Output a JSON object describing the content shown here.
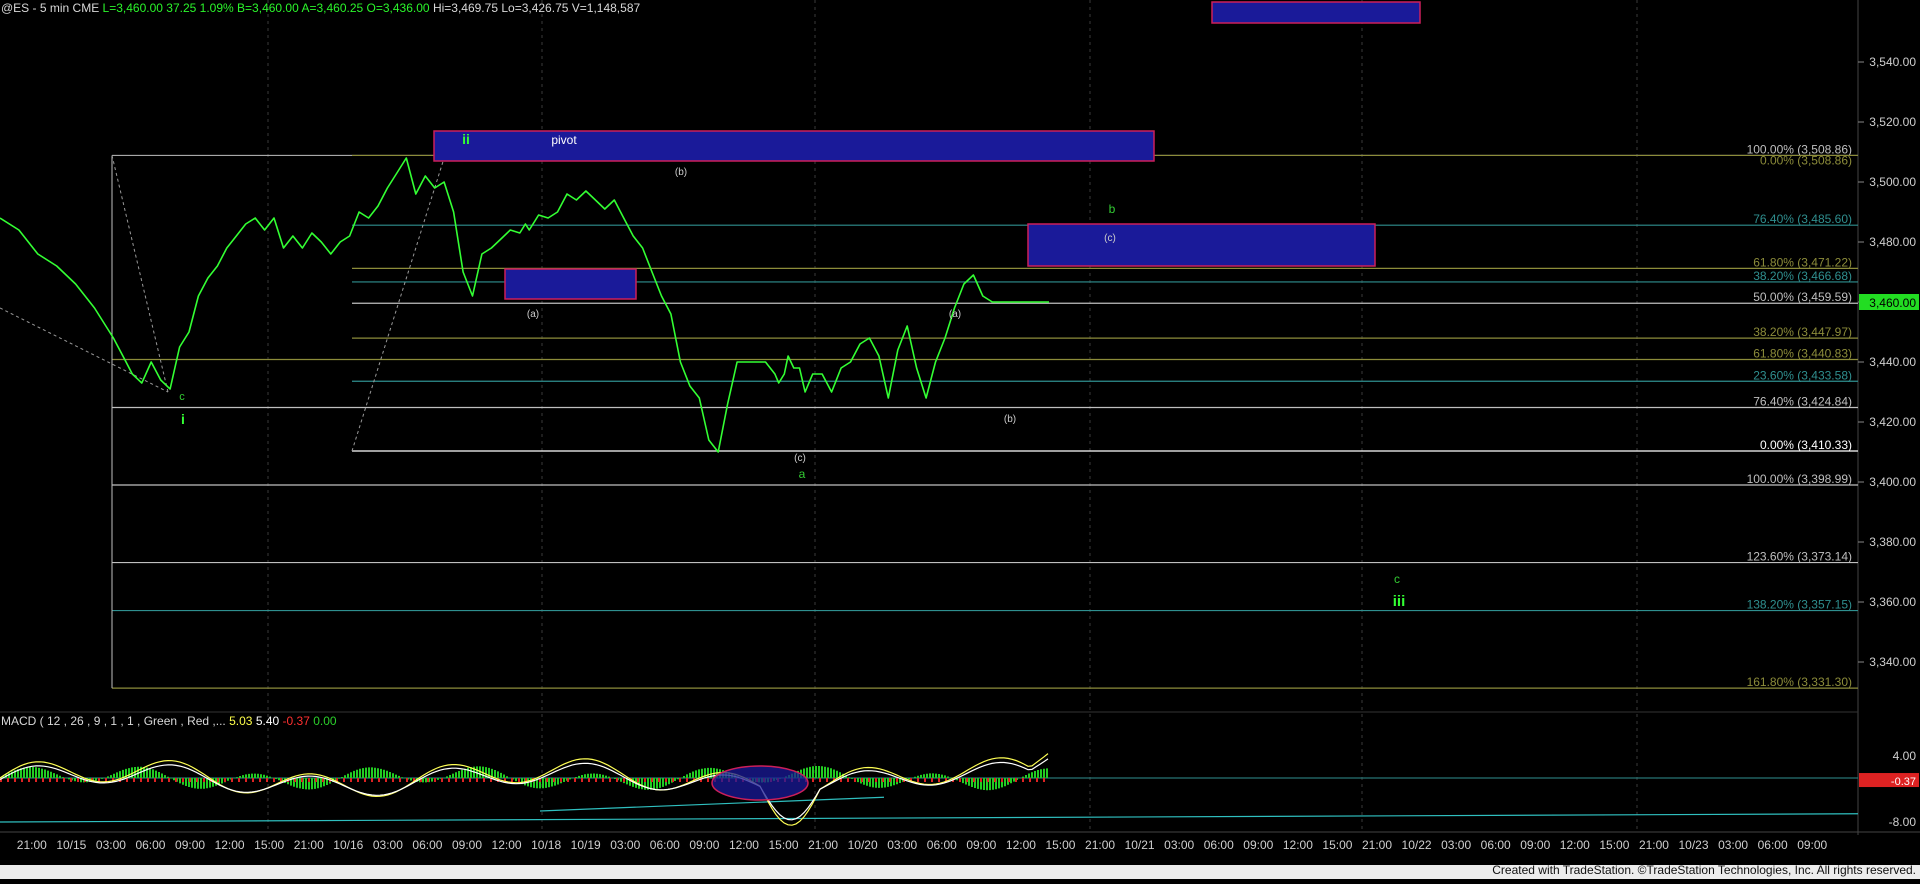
{
  "header": {
    "symbol": "@ES - 5 min  CME",
    "last": "L=3,460.00",
    "change": "37.25",
    "pct": "1.09%",
    "bid": "B=3,460.00",
    "ask": "A=3,460.25",
    "open": "O=3,436.00",
    "high": "Hi=3,469.75",
    "low": "Lo=3,426.75",
    "volume": "V=1,148,587"
  },
  "macd_header": {
    "label": "MACD ( 12 , 26 , 9 , 1 , 1 , Green , Red ,...",
    "v1": "5.03",
    "v2": "5.40",
    "v3": "-0.37",
    "v4": "0.00"
  },
  "credit": "Created with TradeStation. ©TradeStation Technologies, Inc. All rights reserved.",
  "colors": {
    "background": "#000000",
    "price_line": "#33ff33",
    "wave_label": "#33cc33",
    "box_fill": "#1a1a99",
    "box_border": "#cc1f5a",
    "fib_white": "#bfbfbf",
    "fib_teal": "#2f8f8f",
    "fib_olive": "#8c8c3a"
  },
  "chart_data": {
    "type": "line",
    "title": "",
    "ylim": [
      3324,
      3556
    ],
    "y_ticks": [
      3340,
      3360,
      3380,
      3400,
      3420,
      3440,
      3460,
      3480,
      3500,
      3520,
      3540
    ],
    "y_tick_labels": [
      "3,340.00",
      "3,360.00",
      "3,380.00",
      "3,400.00",
      "3,420.00",
      "3,440.00",
      "3,460.00",
      "3,480.00",
      "3,500.00",
      "3,520.00",
      "3,540.00"
    ],
    "current_price_label": "3,460.00",
    "current_price": 3460,
    "x_tick_labels": [
      "21:00",
      "10/15",
      "03:00",
      "06:00",
      "09:00",
      "12:00",
      "15:00",
      "21:00",
      "10/16",
      "03:00",
      "06:00",
      "09:00",
      "12:00",
      "10/18",
      "10/19",
      "03:00",
      "06:00",
      "09:00",
      "12:00",
      "15:00",
      "21:00",
      "10/20",
      "03:00",
      "06:00",
      "09:00",
      "12:00",
      "15:00",
      "21:00",
      "10/21",
      "03:00",
      "06:00",
      "09:00",
      "12:00",
      "15:00",
      "21:00",
      "10/22",
      "03:00",
      "06:00",
      "09:00",
      "12:00",
      "15:00",
      "21:00",
      "10/23",
      "03:00",
      "06:00",
      "09:00"
    ],
    "series": [
      {
        "x": [
          0,
          0.01,
          0.02,
          0.03,
          0.04,
          0.05,
          0.06,
          0.065,
          0.07,
          0.075,
          0.08,
          0.085,
          0.09,
          0.095,
          0.1,
          0.105,
          0.11,
          0.115,
          0.12,
          0.125,
          0.13,
          0.135,
          0.14,
          0.145,
          0.15,
          0.155,
          0.16,
          0.165,
          0.17,
          0.175,
          0.18,
          0.185,
          0.19,
          0.195,
          0.2,
          0.205,
          0.21,
          0.215,
          0.22,
          0.225,
          0.23,
          0.235,
          0.24,
          0.245,
          0.25,
          0.255,
          0.26,
          0.265,
          0.27,
          0.275,
          0.278,
          0.28,
          0.283,
          0.285,
          0.29,
          0.295,
          0.3,
          0.305,
          0.31,
          0.315,
          0.32,
          0.325,
          0.33,
          0.335,
          0.34,
          0.345,
          0.35,
          0.355,
          0.36,
          0.365,
          0.37,
          0.375,
          0.38,
          0.385,
          0.39,
          0.395,
          0.4,
          0.405,
          0.41,
          0.412,
          0.415,
          0.417,
          0.42,
          0.423,
          0.426,
          0.43,
          0.435,
          0.44,
          0.445,
          0.45,
          0.455,
          0.46,
          0.465,
          0.47,
          0.475,
          0.48,
          0.485,
          0.49,
          0.495,
          0.5,
          0.505,
          0.51,
          0.515,
          0.52,
          0.525,
          0.53,
          0.535,
          0.54,
          0.545,
          0.55,
          0.555
        ],
        "y": [
          3488,
          3484,
          3476,
          3472,
          3466,
          3458,
          3448,
          3442,
          3436,
          3433,
          3440,
          3434,
          3431,
          3445,
          3450,
          3462,
          3468,
          3472,
          3478,
          3482,
          3486,
          3488,
          3484,
          3488,
          3478,
          3482,
          3478,
          3483,
          3480,
          3476,
          3480,
          3482,
          3490,
          3488,
          3492,
          3498,
          3503,
          3508,
          3496,
          3502,
          3498,
          3500,
          3490,
          3470,
          3462,
          3476,
          3478,
          3481,
          3484,
          3483,
          3486,
          3484,
          3487,
          3489,
          3488,
          3490,
          3496,
          3494,
          3497,
          3494,
          3491,
          3494,
          3488,
          3482,
          3478,
          3470,
          3462,
          3456,
          3440,
          3432,
          3428,
          3414,
          3410,
          3426,
          3440,
          3440,
          3440,
          3440,
          3436,
          3433,
          3436,
          3442,
          3438,
          3438,
          3430,
          3436,
          3436,
          3430,
          3438,
          3440,
          3446,
          3448,
          3442,
          3428,
          3444,
          3452,
          3438,
          3428,
          3440,
          3448,
          3458,
          3466,
          3469,
          3462,
          3460,
          3460,
          3460,
          3460,
          3460,
          3460,
          3460
        ]
      }
    ],
    "fib_levels": [
      {
        "label": "100.00% (3,508.86)",
        "value": 3508.86
      },
      {
        "label": "0.00% (3,508.86)",
        "value": 3508.86
      },
      {
        "label": "76.40% (3,485.60)",
        "value": 3485.6
      },
      {
        "label": "61.80% (3,471.22)",
        "value": 3471.22
      },
      {
        "label": "38.20% (3,466.68)",
        "value": 3466.68
      },
      {
        "label": "50.00% (3,459.59)",
        "value": 3459.59
      },
      {
        "label": "38.20% (3,447.97)",
        "value": 3447.97
      },
      {
        "label": "61.80% (3,440.83)",
        "value": 3440.83
      },
      {
        "label": "23.60% (3,433.58)",
        "value": 3433.58
      },
      {
        "label": "76.40% (3,424.84)",
        "value": 3424.84
      },
      {
        "label": "0.00% (3,410.33)",
        "value": 3410.33
      },
      {
        "label": "100.00% (3,398.99)",
        "value": 3398.99
      },
      {
        "label": "123.60% (3,373.14)",
        "value": 3373.14
      },
      {
        "label": "138.20% (3,357.15)",
        "value": 3357.15
      },
      {
        "label": "161.80% (3,331.30)",
        "value": 3331.3
      }
    ],
    "wave_labels": [
      "ii",
      "pivot",
      "(b)",
      "b",
      "(c)",
      "(a)",
      "(a)",
      "c",
      "i",
      "(b)",
      "(c)",
      "a",
      "c",
      "iii"
    ],
    "macd_ticks": [
      "4.00",
      "-0.37",
      "-8.00"
    ]
  }
}
